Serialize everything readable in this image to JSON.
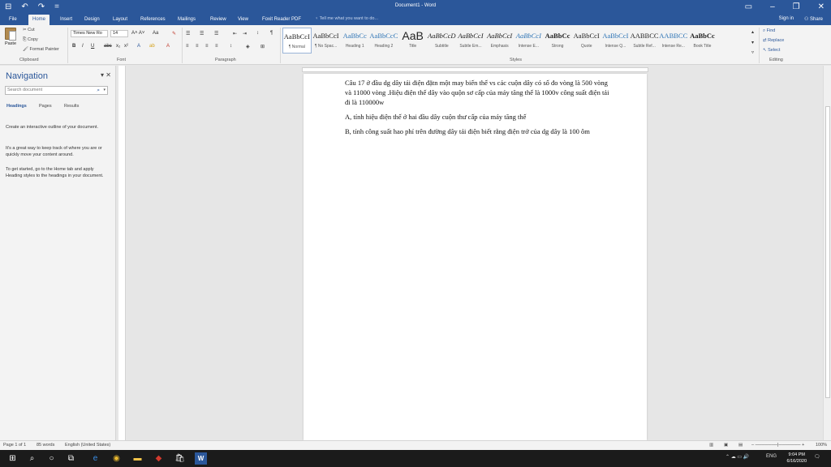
{
  "window": {
    "title": "Document1 - Word",
    "qat": [
      "⊟",
      "↶",
      "↷",
      "="
    ],
    "controls": [
      "▭",
      "–",
      "❐",
      "✕"
    ]
  },
  "tabs": {
    "items": [
      "File",
      "Home",
      "Insert",
      "Design",
      "Layout",
      "References",
      "Mailings",
      "Review",
      "View",
      "Foxit Reader PDF"
    ],
    "active": "Home",
    "tell_me": "Tell me what you want to do...",
    "sign_in": "Sign in",
    "share": "Share"
  },
  "ribbon": {
    "clipboard": {
      "paste": "Paste",
      "cut": "Cut",
      "copy": "Copy",
      "format_painter": "Format Painter",
      "label": "Clipboard"
    },
    "font": {
      "name": "Times New Ro",
      "size": "14",
      "label": "Font"
    },
    "paragraph": {
      "label": "Paragraph"
    },
    "styles": {
      "label": "Styles",
      "items": [
        {
          "sample": "AaBbCcI",
          "name": "¶ Normal"
        },
        {
          "sample": "AaBbCcI",
          "name": "¶ No Spac..."
        },
        {
          "sample": "AaBbCc",
          "name": "Heading 1"
        },
        {
          "sample": "AaBbCcC",
          "name": "Heading 2"
        },
        {
          "sample": "AaB",
          "name": "Title"
        },
        {
          "sample": "AaBbCcD",
          "name": "Subtitle"
        },
        {
          "sample": "AaBbCcI",
          "name": "Subtle Em..."
        },
        {
          "sample": "AaBbCcI",
          "name": "Emphasis"
        },
        {
          "sample": "AaBbCcI",
          "name": "Intense E..."
        },
        {
          "sample": "AaBbCc",
          "name": "Strong"
        },
        {
          "sample": "AaBbCcI",
          "name": "Quote"
        },
        {
          "sample": "AaBbCcI",
          "name": "Intense Q..."
        },
        {
          "sample": "AABBCC",
          "name": "Subtle Ref..."
        },
        {
          "sample": "AABBCC",
          "name": "Intense Re..."
        },
        {
          "sample": "AaBbCc",
          "name": "Book Title"
        }
      ]
    },
    "editing": {
      "find": "Find",
      "replace": "Replace",
      "select": "Select",
      "label": "Editing"
    }
  },
  "navigation": {
    "title": "Navigation",
    "search_placeholder": "Search document",
    "tabs": [
      "Headings",
      "Pages",
      "Results"
    ],
    "hints": [
      "Create an interactive outline of your document.",
      "It's a great way to keep track of where you are or quickly move your content around.",
      "To get started, go to the Home tab and apply Heading styles to the headings in your document."
    ]
  },
  "document": {
    "paragraphs": [
      "Câu 17 ở đầu dg dây tải điện đặtn một may biến thế vs các cuộn dây có số đo vòng là 500 vòng và 11000 vòng .Hiệu điện thế dây vào quộn sơ cấp của máy tăng thế là 1000v công suất điện tải đi là 110000w",
      "A, tính hiệu điện thế ở hai đầu dây cuộn thư cấp của máy tăng thế",
      "B, tính công suất hao phí trên đường dây tải điện biết rằng điện trở của dg dây là 100 ôm"
    ]
  },
  "status": {
    "page": "Page 1 of 1",
    "words": "85 words",
    "language": "English (United States)",
    "zoom": "100%"
  },
  "taskbar": {
    "time": "9:04 PM",
    "date": "6/16/2020",
    "lang": "ENG"
  }
}
